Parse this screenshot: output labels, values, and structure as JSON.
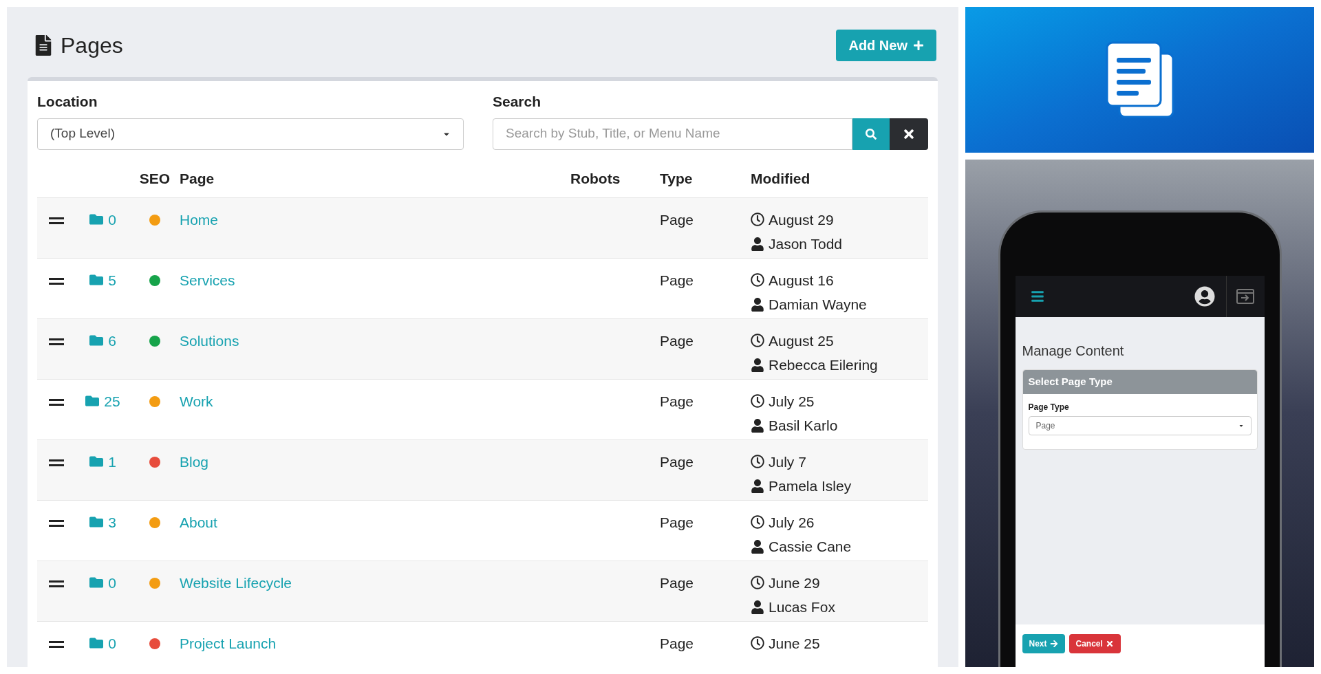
{
  "header": {
    "title": "Pages",
    "add_button": "Add New"
  },
  "filters": {
    "location_label": "Location",
    "location_value": "(Top Level)",
    "search_label": "Search",
    "search_placeholder": "Search by Stub, Title, or Menu Name"
  },
  "table": {
    "columns": [
      "SEO",
      "Page",
      "Robots",
      "Type",
      "Modified"
    ],
    "rows": [
      {
        "folder_count": "0",
        "color": "#f39c12",
        "page": "Home",
        "type": "Page",
        "date": "August 29",
        "user": "Jason Todd"
      },
      {
        "folder_count": "5",
        "color": "#16a34a",
        "page": "Services",
        "type": "Page",
        "date": "August 16",
        "user": "Damian Wayne"
      },
      {
        "folder_count": "6",
        "color": "#16a34a",
        "page": "Solutions",
        "type": "Page",
        "date": "August 25",
        "user": "Rebecca Eilering"
      },
      {
        "folder_count": "25",
        "color": "#f39c12",
        "page": "Work",
        "type": "Page",
        "date": "July 25",
        "user": "Basil Karlo"
      },
      {
        "folder_count": "1",
        "color": "#e74c3c",
        "page": "Blog",
        "type": "Page",
        "date": "July 7",
        "user": "Pamela Isley"
      },
      {
        "folder_count": "3",
        "color": "#f39c12",
        "page": "About",
        "type": "Page",
        "date": "July 26",
        "user": "Cassie Cane"
      },
      {
        "folder_count": "0",
        "color": "#f39c12",
        "page": "Website Lifecycle",
        "type": "Page",
        "date": "June 29",
        "user": "Lucas Fox"
      },
      {
        "folder_count": "0",
        "color": "#e74c3c",
        "page": "Project Launch",
        "type": "Page",
        "date": "June 25"
      }
    ]
  },
  "phone": {
    "heading": "Manage Content",
    "panel_title": "Select Page Type",
    "field_label": "Page Type",
    "field_value": "Page",
    "buttons": [
      {
        "label": "Next",
        "kind": "primary"
      },
      {
        "label": "Cancel",
        "kind": "danger"
      }
    ]
  }
}
